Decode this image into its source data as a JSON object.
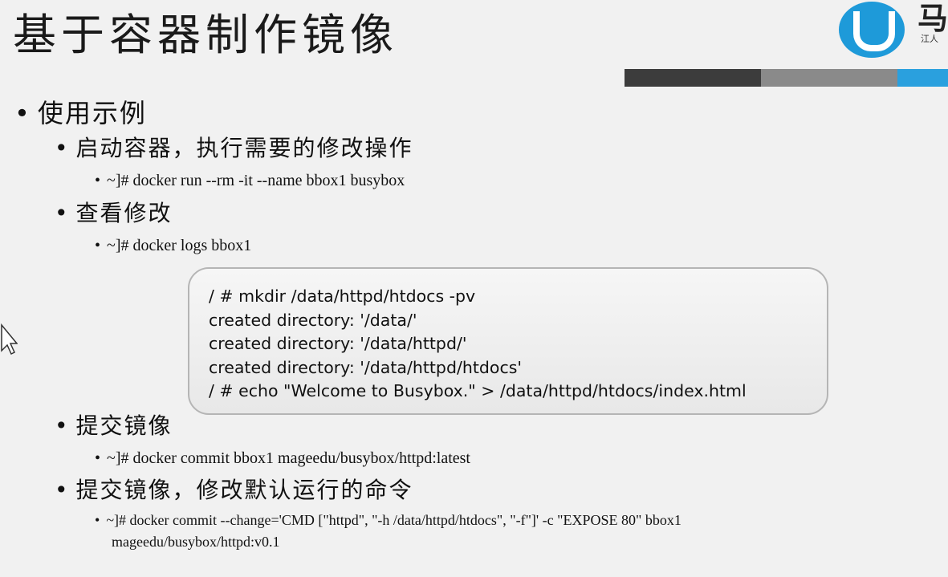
{
  "slide": {
    "title": "基于容器制作镜像"
  },
  "logo": {
    "icon": "magedu-logo-icon",
    "text": "马",
    "subtext": "江人",
    "colors": {
      "circle": "#1e9ad9"
    }
  },
  "accent_bar": {
    "colors": [
      "#3c3c3c",
      "#8a8a8a",
      "#2aa0de"
    ]
  },
  "content": {
    "bullet1": "使用示例",
    "step1": {
      "title": "启动容器，执行需要的修改操作",
      "cmd": "~]# docker run --rm -it --name bbox1 busybox"
    },
    "step2": {
      "title": "查看修改",
      "cmd": "~]# docker logs bbox1"
    },
    "step3": {
      "title": "提交镜像",
      "cmd": "~]# docker commit bbox1 mageedu/busybox/httpd:latest"
    },
    "step4": {
      "title": "提交镜像，修改默认运行的命令",
      "cmd_line1": "~]#  docker commit --change='CMD [\"httpd\", \"-h /data/httpd/htdocs\", \"-f\"]' -c \"EXPOSE 80\" bbox1",
      "cmd_line2": "mageedu/busybox/httpd:v0.1"
    }
  },
  "terminal": {
    "lines": [
      "/ # mkdir /data/httpd/htdocs -pv",
      "created directory: '/data/'",
      "created directory: '/data/httpd/'",
      "created directory: '/data/httpd/htdocs'",
      "/ # echo \"Welcome to Busybox.\" > /data/httpd/htdocs/index.html"
    ]
  }
}
